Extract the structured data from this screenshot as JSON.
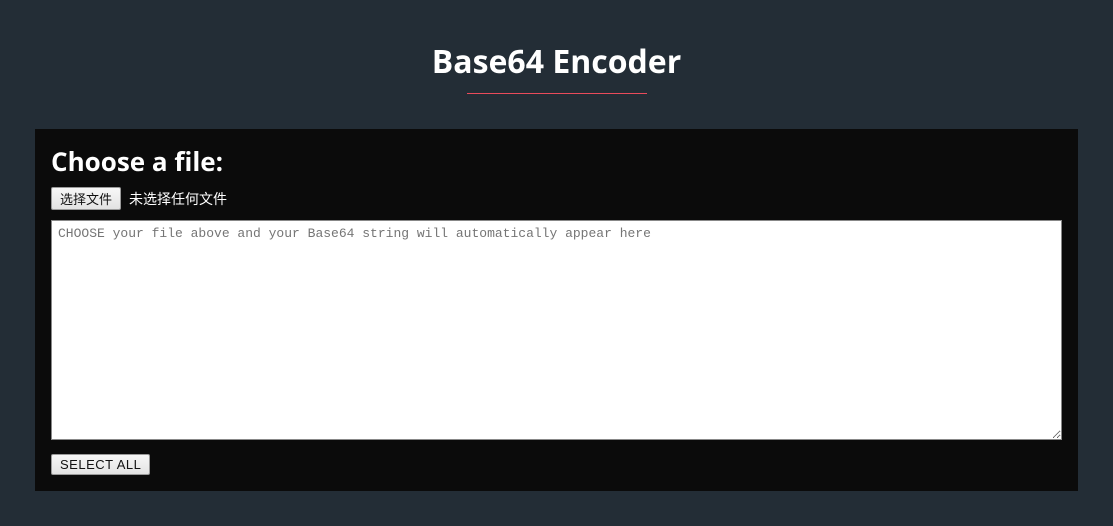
{
  "header": {
    "title": "Base64 Encoder"
  },
  "panel": {
    "choose_heading": "Choose a file:",
    "file_button_label": "选择文件",
    "file_status_text": "未选择任何文件",
    "textarea_placeholder": "CHOOSE your file above and your Base64 string will automatically appear here",
    "textarea_value": "",
    "select_all_label": "SELECT ALL"
  },
  "colors": {
    "background": "#232d36",
    "panel_bg": "#0b0b0b",
    "accent": "#e94b5b"
  }
}
